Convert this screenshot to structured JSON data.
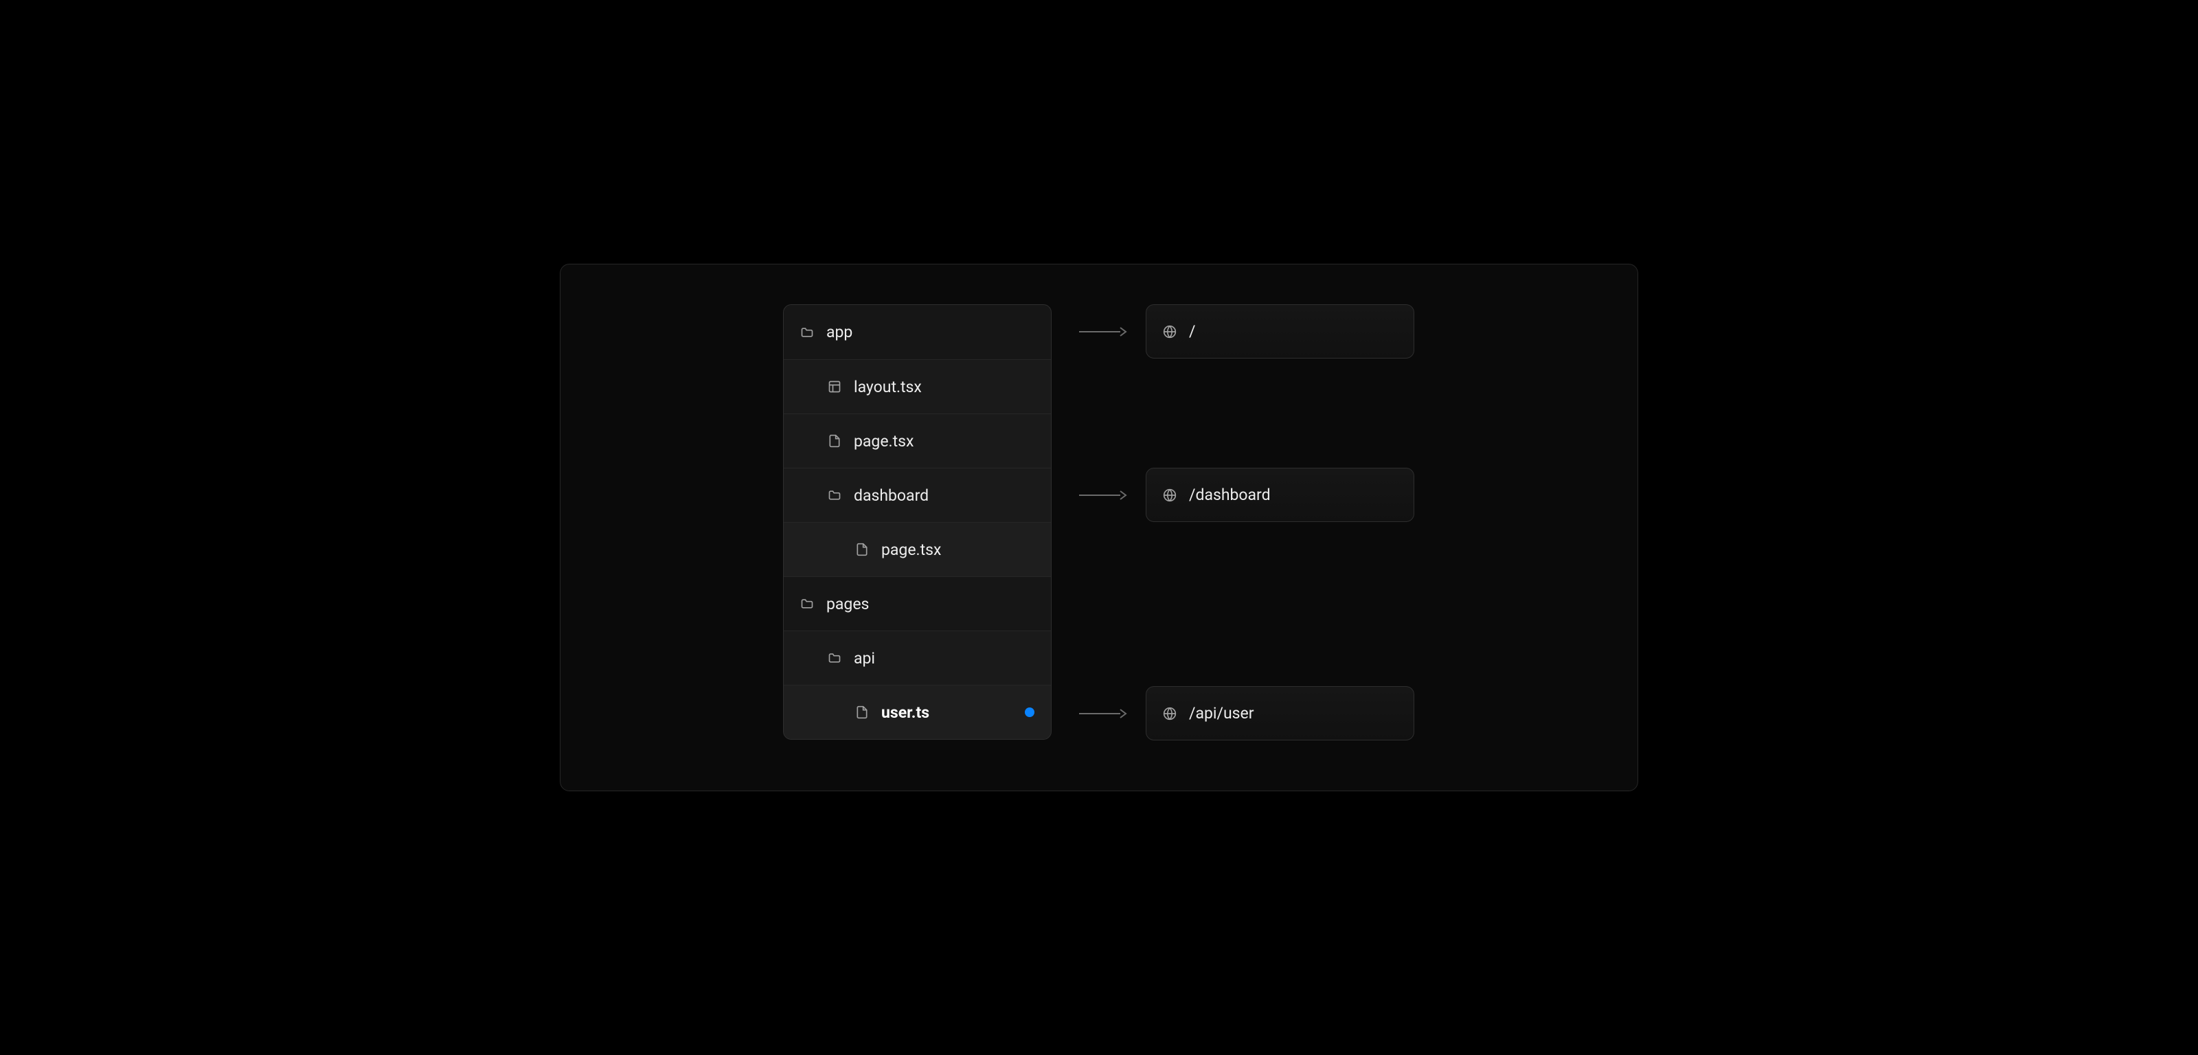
{
  "tree": {
    "items": [
      {
        "label": "app",
        "icon": "folder",
        "depth": 0,
        "active": false
      },
      {
        "label": "layout.tsx",
        "icon": "layout",
        "depth": 1,
        "active": false
      },
      {
        "label": "page.tsx",
        "icon": "file",
        "depth": 1,
        "active": false
      },
      {
        "label": "dashboard",
        "icon": "folder",
        "depth": 1,
        "active": false
      },
      {
        "label": "page.tsx",
        "icon": "file",
        "depth": 2,
        "active": false
      },
      {
        "label": "pages",
        "icon": "folder",
        "depth": 0,
        "active": false
      },
      {
        "label": "api",
        "icon": "folder",
        "depth": 1,
        "active": false
      },
      {
        "label": "user.ts",
        "icon": "file",
        "depth": 2,
        "active": true
      }
    ]
  },
  "routes": [
    {
      "path": "/",
      "tree_index": 0
    },
    {
      "path": "/dashboard",
      "tree_index": 3
    },
    {
      "path": "/api/user",
      "tree_index": 7
    }
  ],
  "colors": {
    "accent": "#0a84ff"
  }
}
